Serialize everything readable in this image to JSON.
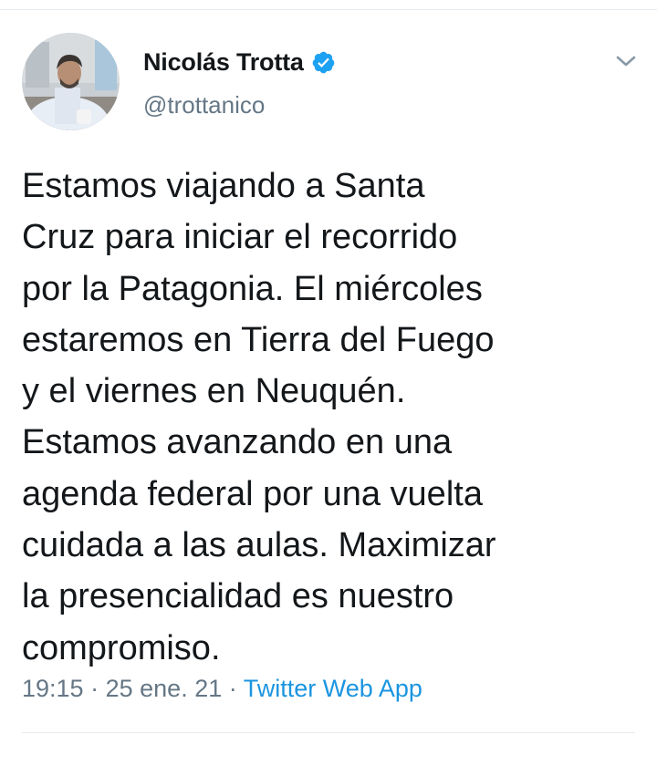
{
  "author": {
    "display_name": "Nicolás Trotta",
    "handle": "@trottanico",
    "verified": true
  },
  "tweet": {
    "text": "Estamos viajando a Santa\nCruz para iniciar el recorrido\npor la Patagonia. El miércoles\nestaremos en Tierra del Fuego\ny el viernes en Neuquén.\nEstamos avanzando en una\nagenda federal por una vuelta\ncuidada a las aulas. Maximizar\nla presencialidad es nuestro\ncompromiso.",
    "time": "19:15",
    "date": "25 ene. 21",
    "separator": "·",
    "source": "Twitter Web App"
  },
  "icons": {
    "verified": "verified-badge-icon",
    "menu": "chevron-down-icon"
  },
  "colors": {
    "text": "#14171a",
    "secondary": "#657786",
    "link": "#1b95e0",
    "verified": "#1da1f2",
    "divider": "#e6ecf0"
  }
}
